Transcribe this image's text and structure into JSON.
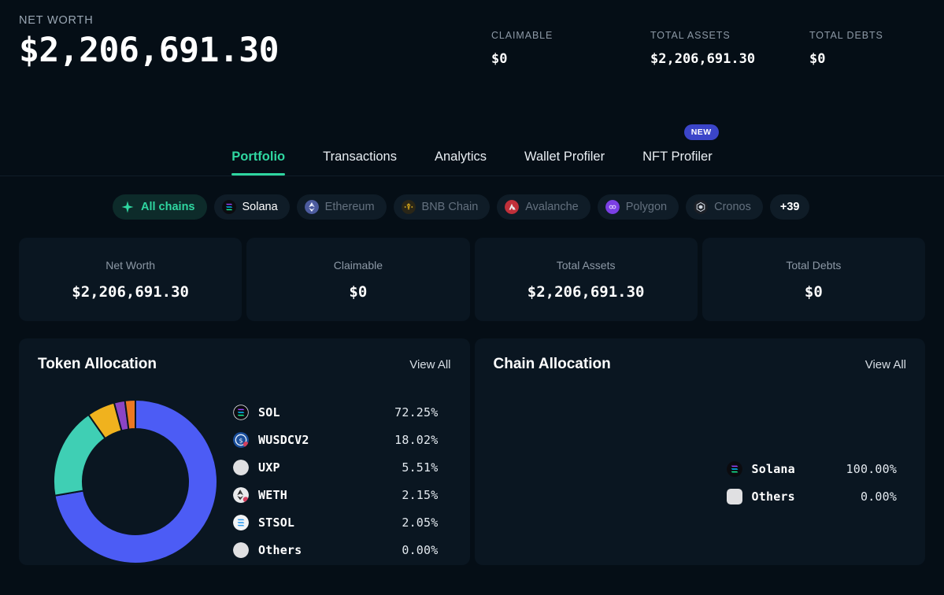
{
  "header": {
    "net_worth_label": "NET WORTH",
    "net_worth_value": "$2,206,691.30",
    "stats": [
      {
        "label": "CLAIMABLE",
        "value": "$0"
      },
      {
        "label": "TOTAL ASSETS",
        "value": "$2,206,691.30"
      },
      {
        "label": "TOTAL DEBTS",
        "value": "$0"
      }
    ]
  },
  "tabs": [
    {
      "label": "Portfolio",
      "active": true,
      "badge": ""
    },
    {
      "label": "Transactions",
      "active": false,
      "badge": ""
    },
    {
      "label": "Analytics",
      "active": false,
      "badge": ""
    },
    {
      "label": "Wallet Profiler",
      "active": false,
      "badge": ""
    },
    {
      "label": "NFT Profiler",
      "active": false,
      "badge": "NEW"
    }
  ],
  "chains": [
    {
      "label": "All chains",
      "icon": "sparkle-icon",
      "state": "all",
      "color": "#2fd6a0"
    },
    {
      "label": "Solana",
      "icon": "solana-icon",
      "state": "selected",
      "color": "#14f195"
    },
    {
      "label": "Ethereum",
      "icon": "ethereum-icon",
      "state": "dim",
      "color": "#627eea"
    },
    {
      "label": "BNB Chain",
      "icon": "bnb-icon",
      "state": "dim",
      "color": "#f0b90b"
    },
    {
      "label": "Avalanche",
      "icon": "avalanche-icon",
      "state": "dim",
      "color": "#e84142"
    },
    {
      "label": "Polygon",
      "icon": "polygon-icon",
      "state": "dim",
      "color": "#8247e5"
    },
    {
      "label": "Cronos",
      "icon": "cronos-icon",
      "state": "dim",
      "color": "#1c1f24"
    },
    {
      "label": "+39",
      "icon": "",
      "state": "more",
      "color": "#ffffff"
    }
  ],
  "stat_cards": [
    {
      "label": "Net Worth",
      "value": "$2,206,691.30"
    },
    {
      "label": "Claimable",
      "value": "$0"
    },
    {
      "label": "Total Assets",
      "value": "$2,206,691.30"
    },
    {
      "label": "Total Debts",
      "value": "$0"
    }
  ],
  "token_panel": {
    "title": "Token Allocation",
    "view_all": "View All"
  },
  "chain_panel": {
    "title": "Chain Allocation",
    "view_all": "View All"
  },
  "chart_data": [
    {
      "type": "pie",
      "title": "Token Allocation",
      "categories": [
        "SOL",
        "WUSDCV2",
        "UXP",
        "WETH",
        "STSOL",
        "Others"
      ],
      "values": [
        72.25,
        18.02,
        5.51,
        2.15,
        2.05,
        0.0
      ],
      "labels": [
        "72.25%",
        "18.02%",
        "5.51%",
        "2.15%",
        "2.05%",
        "0.00%"
      ],
      "colors": [
        "#4c5cf5",
        "#3fcfb4",
        "#f0b21e",
        "#8b44c4",
        "#ec7821",
        "#e2e2e2"
      ],
      "icons": [
        "solana-icon",
        "wusdcv2-icon",
        "uxp-icon",
        "weth-icon",
        "stsol-icon",
        "others-icon"
      ],
      "donut": true,
      "legend_position": "right"
    },
    {
      "type": "pie",
      "title": "Chain Allocation",
      "categories": [
        "Solana",
        "Others"
      ],
      "values": [
        100.0,
        0.0
      ],
      "labels": [
        "100.00%",
        "0.00%"
      ],
      "colors": [
        "#7c3aed",
        "#e2e2e2"
      ],
      "icons": [
        "solana-icon",
        "others-icon"
      ],
      "donut": true,
      "legend_position": "right"
    }
  ]
}
